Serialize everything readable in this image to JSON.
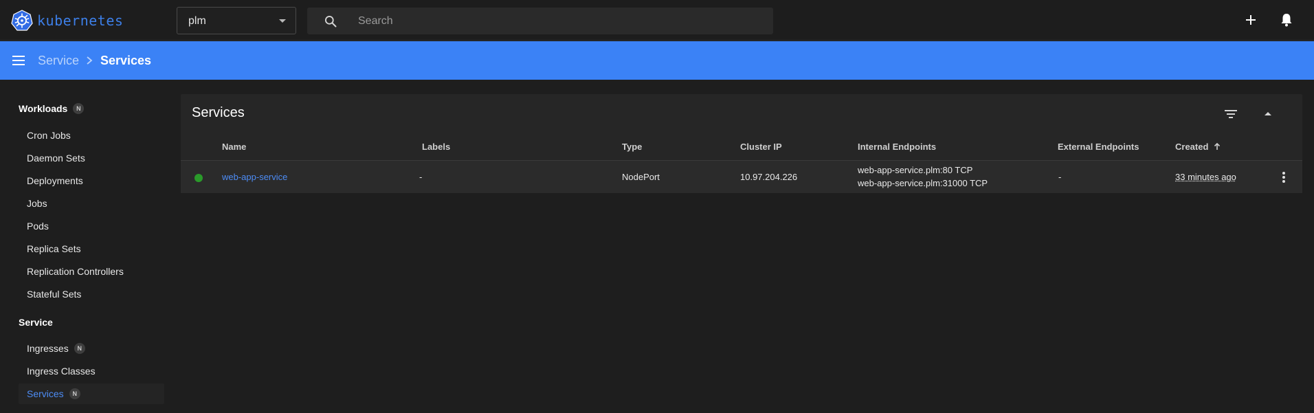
{
  "app": {
    "name": "kubernetes"
  },
  "topbar": {
    "namespace": "plm",
    "search_placeholder": "Search"
  },
  "breadcrumb": {
    "parent": "Service",
    "current": "Services"
  },
  "sidebar": {
    "workloads": {
      "label": "Workloads",
      "badge": "N",
      "items": [
        "Cron Jobs",
        "Daemon Sets",
        "Deployments",
        "Jobs",
        "Pods",
        "Replica Sets",
        "Replication Controllers",
        "Stateful Sets"
      ]
    },
    "service": {
      "label": "Service",
      "items": [
        {
          "label": "Ingresses",
          "badge": "N"
        },
        {
          "label": "Ingress Classes"
        },
        {
          "label": "Services",
          "badge": "N",
          "active": true
        }
      ]
    }
  },
  "card": {
    "title": "Services",
    "columns": [
      "Name",
      "Labels",
      "Type",
      "Cluster IP",
      "Internal Endpoints",
      "External Endpoints",
      "Created"
    ],
    "rows": [
      {
        "status": "running",
        "name": "web-app-service",
        "labels": "-",
        "type": "NodePort",
        "cluster_ip": "10.97.204.226",
        "internal_endpoints": [
          "web-app-service.plm:80 TCP",
          "web-app-service.plm:31000 TCP"
        ],
        "external_endpoints": "-",
        "created": "33 minutes ago"
      }
    ]
  },
  "colors": {
    "accent": "#3b82f6",
    "link": "#4d8cf5",
    "status_ok": "#2a9a2a",
    "background": "#1e1e1e"
  }
}
